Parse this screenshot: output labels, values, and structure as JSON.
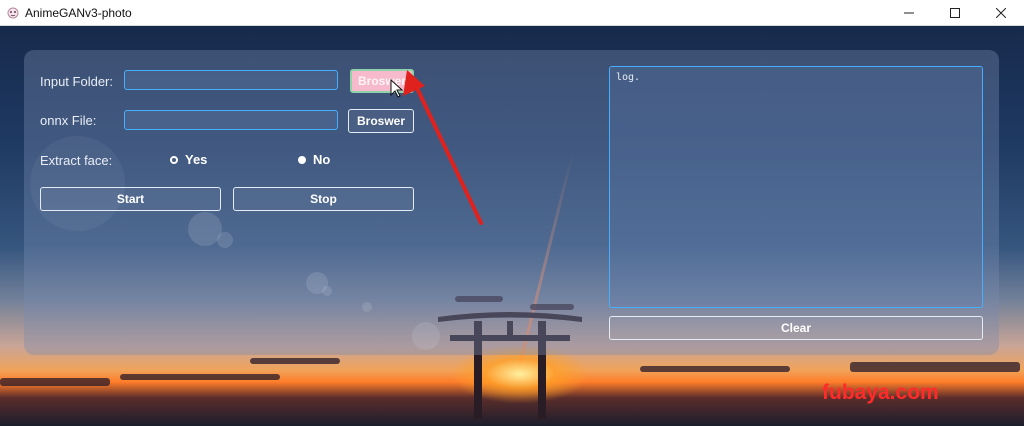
{
  "window": {
    "title": "AnimeGANv3-photo",
    "controls": [
      "minimize-icon",
      "maximize-icon",
      "close-icon"
    ]
  },
  "form": {
    "input_folder_label": "Input Folder:",
    "input_folder_value": "",
    "input_browse_label": "Broswer",
    "onnx_file_label": "onnx File:",
    "onnx_file_value": "",
    "onnx_browse_label": "Broswer",
    "extract_face_label": "Extract face:",
    "options": [
      {
        "label": "Yes",
        "selected": false
      },
      {
        "label": "No",
        "selected": true
      }
    ],
    "start_label": "Start",
    "stop_label": "Stop"
  },
  "log": {
    "text": "log."
  },
  "clear_label": "Clear",
  "watermark": "fubaya.com",
  "colors": {
    "field_border": "#45b0ff",
    "hover_button_bg": "#f7b9cc",
    "hover_button_border": "#8fd4a9",
    "arrow": "#e0221e",
    "watermark": "#ff2a2a"
  },
  "annotation": {
    "arrow_icon": "red-arrow-icon",
    "cursor_icon": "mouse-cursor-icon"
  }
}
